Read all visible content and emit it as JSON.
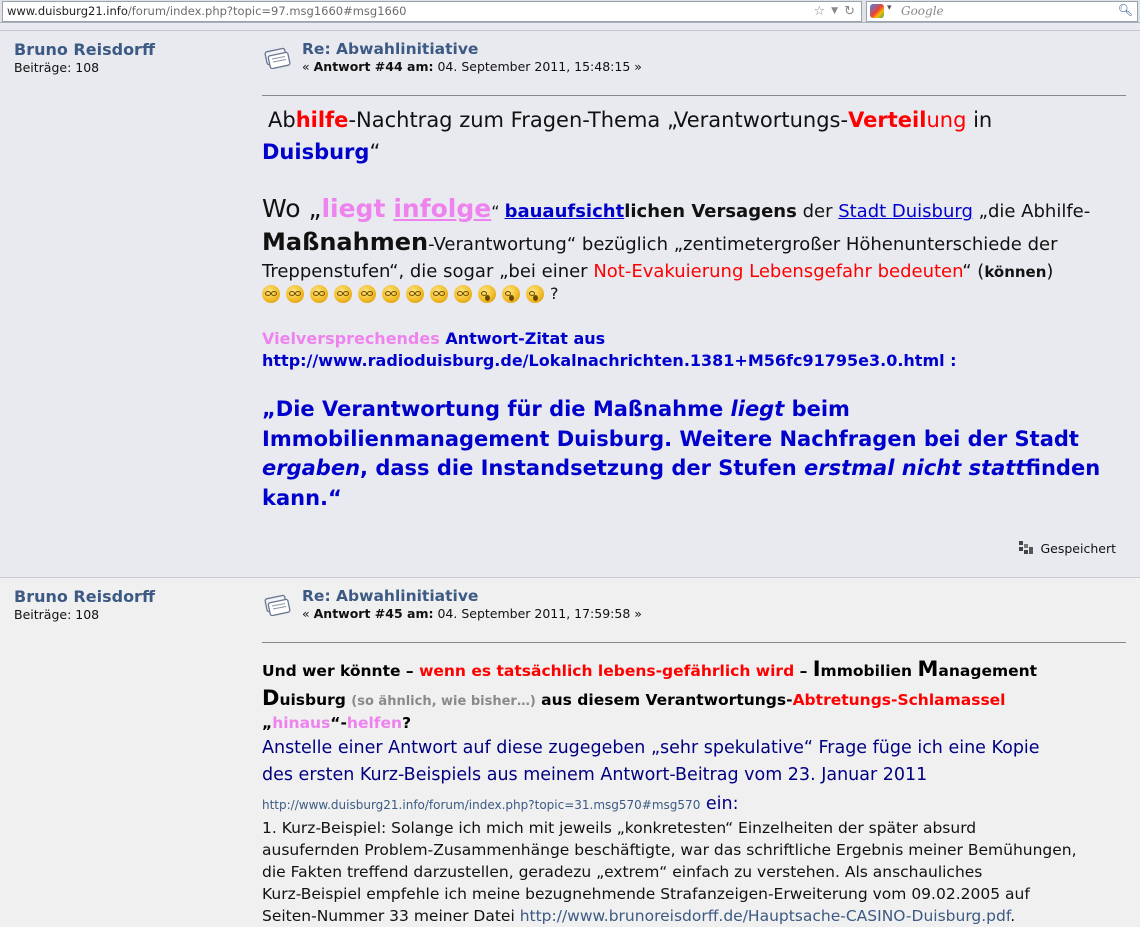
{
  "browser": {
    "url_domain": "www.duisburg21.info",
    "url_path": "/forum/index.php?topic=97.msg1660#msg1660",
    "search_placeholder": "Google"
  },
  "posts": [
    {
      "author": "Bruno Reisdorff",
      "posts_label": "Beiträge: 108",
      "subject": "Re: Abwahlinitiative",
      "reply_label": "Antwort #44 am:",
      "date": "04. September 2011, 15:48:15",
      "saved_label": "Gespeichert"
    },
    {
      "author": "Bruno Reisdorff",
      "posts_label": "Beiträge: 108",
      "subject": "Re: Abwahlinitiative",
      "reply_label": "Antwort #45 am:",
      "date": "04. September 2011, 17:59:58"
    }
  ],
  "post1": {
    "line1": {
      "a": "Ab",
      "b": "hilfe",
      "c": "-Nachtrag zum Fragen-Thema „Verantwortungs-",
      "d": "Verteil",
      "e": "ung",
      "f": " in"
    },
    "line2": {
      "a": "Duisburg",
      "b": "“"
    },
    "q": {
      "wo": "Wo „",
      "liegt": "liegt",
      "infolge": "infolge",
      "close": "“ ",
      "link1": "bauaufsicht",
      "bold1": "lichen Versagens",
      "der": " der ",
      "link2": "Stadt Duisburg",
      "rest1": " „die Abhilfe-",
      "mass": "Maßnahmen",
      "rest2": "-Verantwortung“ bezüglich „zentimetergroßer Höhenunterschiede der",
      "rest3": "Treppenstufen“,  die sogar „bei einer ",
      "red": "Not-Evakuierung Lebensgefahr bedeuten",
      "rest4": "“ (",
      "koennen": "können",
      "rest5": ")",
      "end": "?"
    },
    "zitat": {
      "pink": "Vielversprechendes",
      "blue": " Antwort-Zitat aus"
    },
    "zitat_url": " http://www.radioduisburg.de/Lokalnachrichten.1381+M56fc91795e3.0.html :",
    "quote": {
      "l1a": "„Die Verantwortung für die Maßnahme ",
      "l1b": "liegt",
      "l1c": " beim",
      "l2": "Immobilienmanagement Duisburg. Weitere Nachfragen bei der Stadt",
      "l3a": "ergaben",
      "l3b": ", dass die Instandsetzung der Stufen ",
      "l3c": "erstmal nicht statt",
      "l3d": "finden",
      "l4": "kann.“"
    }
  },
  "post2": {
    "l1": {
      "a": "Und wer könnte – ",
      "b": "wenn es tatsächlich lebens-gefährlich wird",
      "c": " – ",
      "I": "I",
      "d": "mmobilien ",
      "M": "M",
      "e": "anagement"
    },
    "l2": {
      "D": "D",
      "a": "uisburg ",
      "gray": "(so ähnlich, wie bisher…)",
      "b": " aus diesem Verantwortungs-",
      "red": "Abtretungs-Schlamassel"
    },
    "l3": {
      "a": "„",
      "hin": "hinaus",
      "b": "“-",
      "helf": "helfen",
      "c": "?"
    },
    "l4": "Anstelle einer Antwort auf diese zugegeben „sehr spekulative“ Frage füge ich eine Kopie",
    "l5": "des ersten Kurz-Beispiels aus meinem Antwort-Beitrag vom  23. Januar 2011",
    "link": "http://www.duisburg21.info/forum/index.php?topic=31.msg570#msg570",
    "ein": " ein:",
    "p1": "1.    Kurz-Beispiel: Solange ich mich mit jeweils „konkretesten“ Einzelheiten der später absurd",
    "p2": "ausufernden Problem-Zusammenhänge beschäftigte, war das schriftliche Ergebnis meiner Bemühungen,",
    "p3": "die Fakten treffend darzustellen, geradezu „extrem“ einfach zu verstehen. Als anschauliches",
    "p4": "Kurz-Beispiel empfehle ich meine bezugnehmende Strafanzeigen-Erweiterung vom 09.02.2005 auf",
    "p5a": "Seiten-Nummer 33 meiner Datei ",
    "p5link": "http://www.brunoreisdorff.de/Hauptsache-CASINO-Duisburg.pdf",
    "p5b": "."
  },
  "icons": [
    "star-icon",
    "dropdown-icon",
    "reload-icon",
    "google-icon",
    "search-icon",
    "message-icon",
    "smiley-icon",
    "saved-icon"
  ],
  "colors": {
    "link": "#3c5a83",
    "red": "#ff0000",
    "blue": "#0000cc",
    "pink": "#ee82ee",
    "navy": "#000080"
  }
}
